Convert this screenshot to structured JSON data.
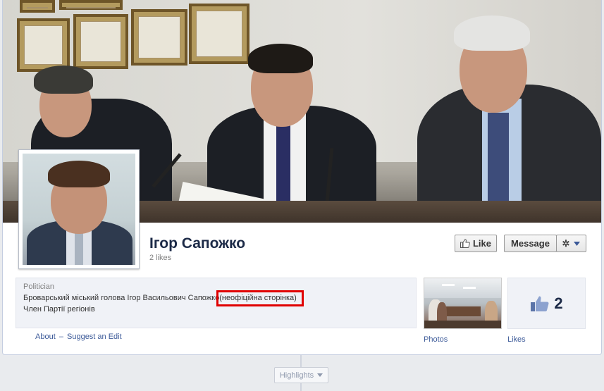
{
  "page": {
    "name": "Ігор Сапожко",
    "likes_text": "2 likes",
    "category": "Politician",
    "description_main": "Броварський міський голова Ігор Васильович Сапожко",
    "description_tag": "(неофіційна сторінка)",
    "description_line2": "Член Партії регіонів"
  },
  "actions": {
    "like_label": "Like",
    "message_label": "Message"
  },
  "links": {
    "about": "About",
    "separator": "–",
    "suggest_edit": "Suggest an Edit"
  },
  "apps": {
    "photos_label": "Photos",
    "likes_label": "Likes",
    "likes_value": "2"
  },
  "timeline": {
    "highlights_label": "Highlights"
  },
  "icons": {
    "like_button_icon": "thumbs-up-icon",
    "gear_icon": "gear-icon",
    "dropdown_icon": "chevron-down-icon",
    "likes_app_icon": "thumbs-up-icon"
  },
  "colors": {
    "link": "#3b5998",
    "name": "#1c2a47",
    "highlight_border": "#e00000"
  }
}
